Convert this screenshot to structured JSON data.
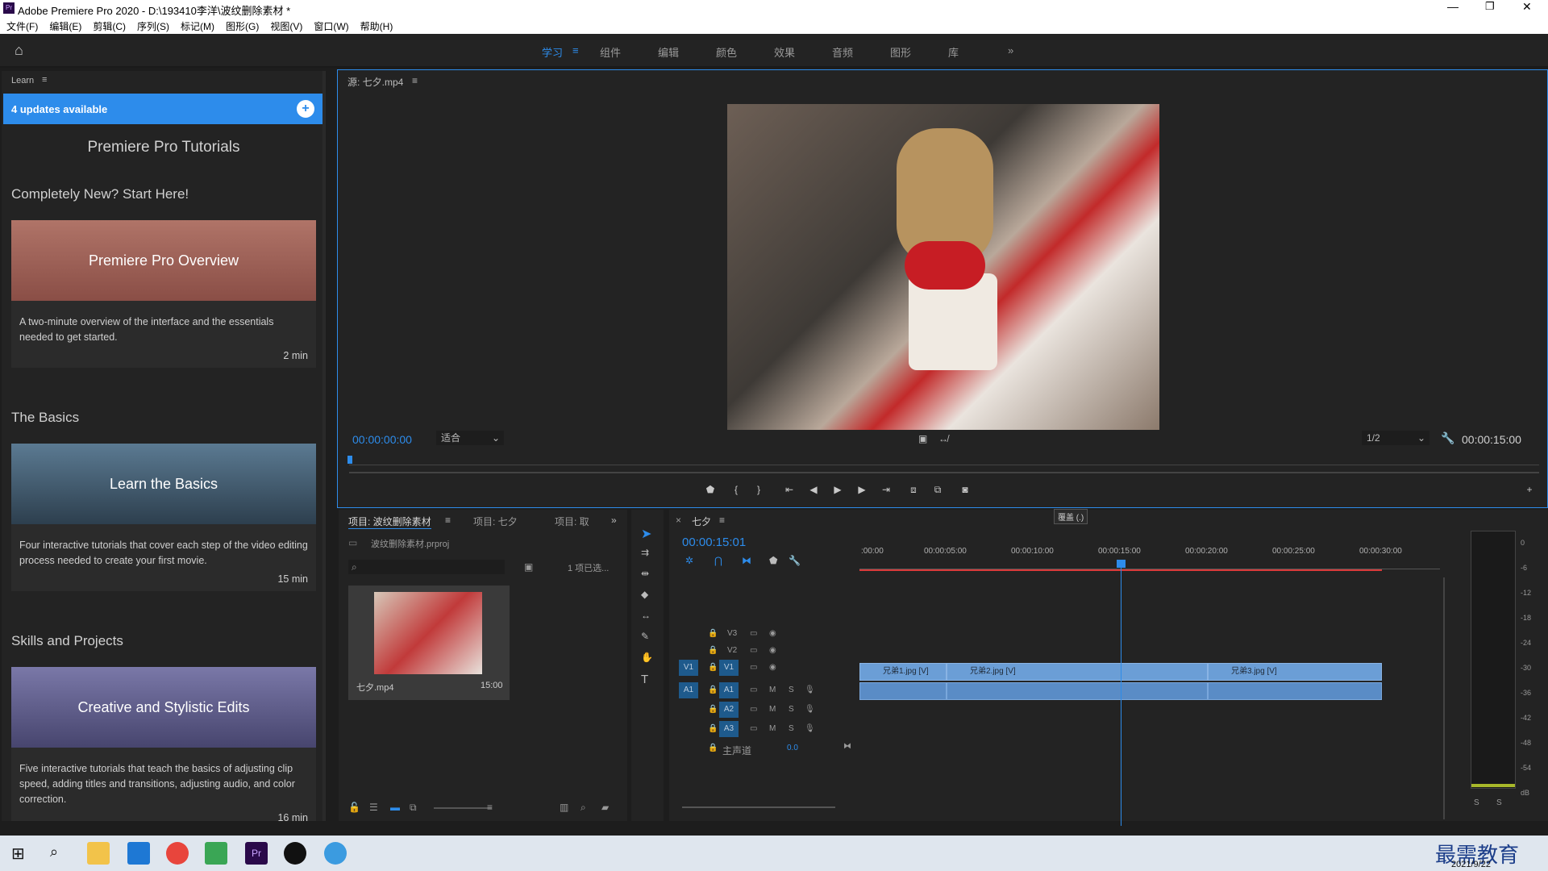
{
  "window": {
    "title": "Adobe Premiere Pro 2020 - D:\\193410李洋\\波纹删除素材 *"
  },
  "menu": [
    "文件(F)",
    "编辑(E)",
    "剪辑(C)",
    "序列(S)",
    "标记(M)",
    "图形(G)",
    "视图(V)",
    "窗口(W)",
    "帮助(H)"
  ],
  "workspaces": {
    "active": "学习",
    "tabs": [
      "组件",
      "编辑",
      "颜色",
      "效果",
      "音频",
      "图形",
      "库"
    ]
  },
  "learn": {
    "panel_label": "Learn",
    "updates": "4 updates available",
    "heading": "Premiere Pro Tutorials",
    "sections": [
      {
        "title": "Completely New? Start Here!",
        "card": {
          "title": "Premiere Pro Overview",
          "desc": "A two-minute overview of the interface and the essentials needed to get started.",
          "min": "2 min"
        }
      },
      {
        "title": "The Basics",
        "card": {
          "title": "Learn the Basics",
          "desc": "Four interactive tutorials that cover each step of the video editing process needed to create your first movie.",
          "min": "15 min"
        }
      },
      {
        "title": "Skills and Projects",
        "card": {
          "title": "Creative and Stylistic Edits",
          "desc": "Five interactive tutorials that teach the basics of adjusting clip speed, adding titles and transitions, adjusting audio, and color correction.",
          "min": "16 min"
        }
      }
    ]
  },
  "source": {
    "tab": "源: 七夕.mp4",
    "timecode": "00:00:00:00",
    "fit": "适合",
    "resolution": "1/2",
    "duration": "00:00:15:00",
    "tooltip": "覆盖 (.)"
  },
  "project": {
    "tabs": [
      "项目: 波纹删除素材",
      "项目: 七夕",
      "项目: 取"
    ],
    "file": "波纹删除素材.prproj",
    "selected": "1 项已选...",
    "item_name": "七夕.mp4",
    "item_dur": "15:00"
  },
  "timeline": {
    "seq": "七夕",
    "timecode": "00:00:15:01",
    "ruler": [
      ":00:00",
      "00:00:05:00",
      "00:00:10:00",
      "00:00:15:00",
      "00:00:20:00",
      "00:00:25:00",
      "00:00:30:00"
    ],
    "tracks_v": [
      "V3",
      "V2",
      "V1"
    ],
    "tracks_a": [
      "A1",
      "A2",
      "A3"
    ],
    "master": "主声道",
    "master_val": "0.0",
    "clips": [
      "兄弟1.jpg [V]",
      "兄弟2.jpg [V]",
      "兄弟3.jpg [V]"
    ]
  },
  "meter": {
    "ticks": [
      "0",
      "-6",
      "-12",
      "-18",
      "-24",
      "-30",
      "-36",
      "-42",
      "-48",
      "-54",
      "dB"
    ]
  },
  "taskbar": {
    "date": "2021/9/22",
    "watermark": "最需教育"
  }
}
